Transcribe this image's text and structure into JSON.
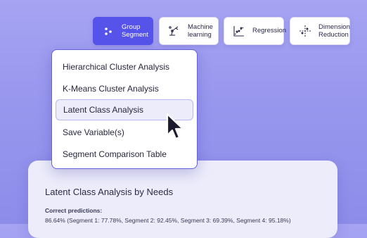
{
  "toolbar": {
    "items": [
      {
        "label_line1": "Group",
        "label_line2": "Segment",
        "icon": "dots-icon",
        "active": true
      },
      {
        "label_line1": "Machine",
        "label_line2": "learning",
        "icon": "robot-arm-icon",
        "active": false
      },
      {
        "label": "Regression",
        "icon": "regression-icon",
        "active": false
      },
      {
        "label_line1": "Dimension",
        "label_line2": "Reduction",
        "icon": "axis-reduction-icon",
        "active": false
      }
    ]
  },
  "menu": {
    "items": [
      {
        "label": "Hierarchical Cluster Analysis"
      },
      {
        "label": "K-Means Cluster Analysis"
      },
      {
        "label": "Latent Class Analysis",
        "selected": true
      },
      {
        "label": "Save Variable(s)"
      },
      {
        "label": "Segment Comparison Table"
      }
    ]
  },
  "card": {
    "title": "Latent Class Analysis by Needs",
    "subtitle": "Correct predictions:",
    "text": "86.64% (Segment 1: 77.78%, Segment 2: 92.45%, Segment 3: 69.39%, Segment 4: 95.18%)"
  },
  "colors": {
    "accent": "#5553ea",
    "background": "#9a98ee",
    "card": "#ececfb"
  },
  "cursor": {
    "icon": "mouse-pointer-icon"
  }
}
